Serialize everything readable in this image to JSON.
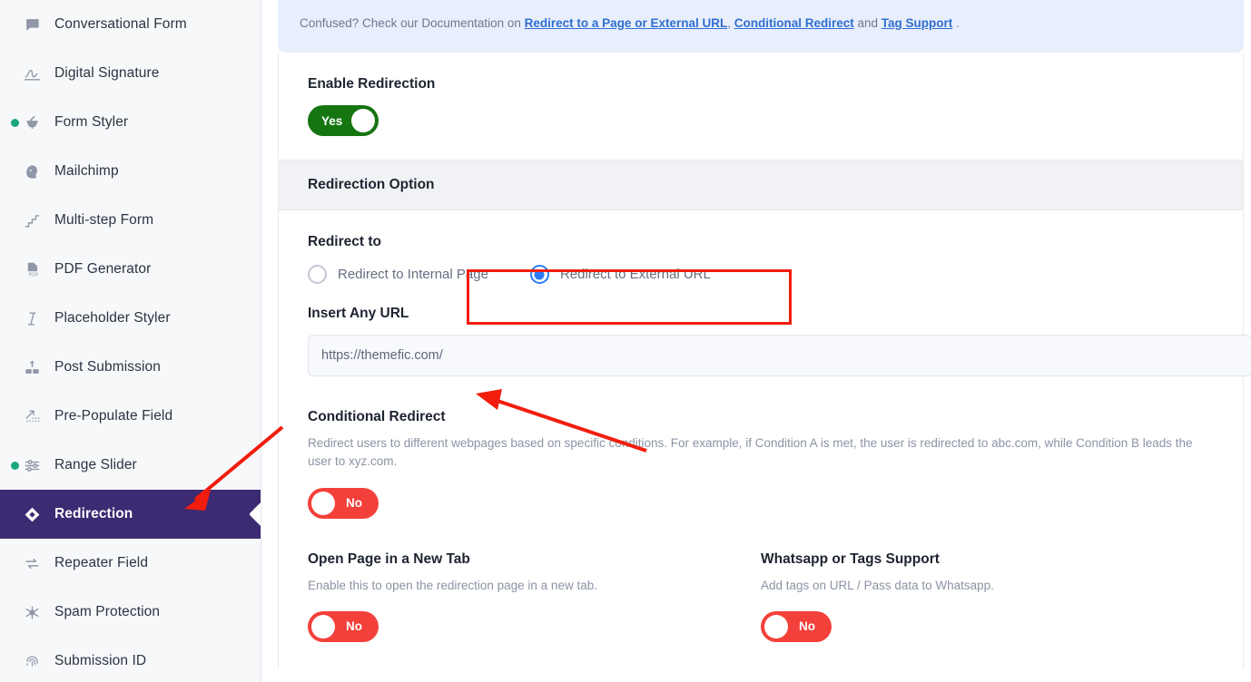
{
  "sidebar": {
    "items": [
      {
        "label": "Conversational Form",
        "icon": "chat-bubble-icon",
        "active": false,
        "status_dot": false
      },
      {
        "label": "Digital Signature",
        "icon": "signature-icon",
        "active": false,
        "status_dot": false
      },
      {
        "label": "Form Styler",
        "icon": "mortar-pestle-icon",
        "active": false,
        "status_dot": true
      },
      {
        "label": "Mailchimp",
        "icon": "mailchimp-icon",
        "active": false,
        "status_dot": false
      },
      {
        "label": "Multi-step Form",
        "icon": "steps-icon",
        "active": false,
        "status_dot": false
      },
      {
        "label": "PDF Generator",
        "icon": "pdf-file-icon",
        "active": false,
        "status_dot": false
      },
      {
        "label": "Placeholder Styler",
        "icon": "italic-text-icon",
        "active": false,
        "status_dot": false
      },
      {
        "label": "Post Submission",
        "icon": "post-submission-icon",
        "active": false,
        "status_dot": false
      },
      {
        "label": "Pre-Populate Field",
        "icon": "prepopulate-icon",
        "active": false,
        "status_dot": false
      },
      {
        "label": "Range Slider",
        "icon": "sliders-icon",
        "active": false,
        "status_dot": true
      },
      {
        "label": "Redirection",
        "icon": "redirection-diamond-icon",
        "active": true,
        "status_dot": false
      },
      {
        "label": "Repeater Field",
        "icon": "repeat-arrows-icon",
        "active": false,
        "status_dot": false
      },
      {
        "label": "Spam Protection",
        "icon": "spider-icon",
        "active": false,
        "status_dot": false
      },
      {
        "label": "Submission ID",
        "icon": "fingerprint-icon",
        "active": false,
        "status_dot": false
      }
    ],
    "active_color": "#3C2A73",
    "status_dot_color": "#1AA67F"
  },
  "notice": {
    "prefix": "Confused? Check our Documentation on ",
    "link1": "Redirect to a Page or External URL",
    "sep1": ", ",
    "link2": "Conditional Redirect",
    "sep2": " and ",
    "link3": "Tag Support",
    "suffix": " .",
    "background": "#E8EEFC",
    "link_color": "#2F6FD0"
  },
  "enable_redirection": {
    "title": "Enable Redirection",
    "toggle_value": "Yes",
    "toggle_state": "on",
    "on_color": "#157511"
  },
  "section_header": {
    "title": "Redirection Option"
  },
  "redirect_to": {
    "title": "Redirect to",
    "options": [
      {
        "label": "Redirect to Internal Page",
        "selected": false
      },
      {
        "label": "Redirect to External URL",
        "selected": true
      }
    ],
    "selected_color": "#2B7CF6"
  },
  "insert_url": {
    "title": "Insert Any URL",
    "value": "https://themefic.com/",
    "placeholder": "https://themefic.com/"
  },
  "conditional_redirect": {
    "title": "Conditional Redirect",
    "description": "Redirect users to different webpages based on specific conditions. For example, if Condition A is met, the user is redirected to abc.com, while Condition B leads the user to xyz.com.",
    "toggle_value": "No",
    "toggle_state": "off",
    "off_color": "#F4403A"
  },
  "open_new_tab": {
    "title": "Open Page in a New Tab",
    "description": "Enable this to open the redirection page in a new tab.",
    "toggle_value": "No",
    "toggle_state": "off"
  },
  "whatsapp_tags": {
    "title": "Whatsapp or Tags Support",
    "description": "Add tags on URL / Pass data to Whatsapp.",
    "toggle_value": "No",
    "toggle_state": "off"
  },
  "annotations": {
    "highlight_color": "#F21D0D",
    "box_target": "redirect-to-external-url-option",
    "arrow1_target": "sidebar-item-redirection",
    "arrow2_target": "insert-url-input"
  }
}
